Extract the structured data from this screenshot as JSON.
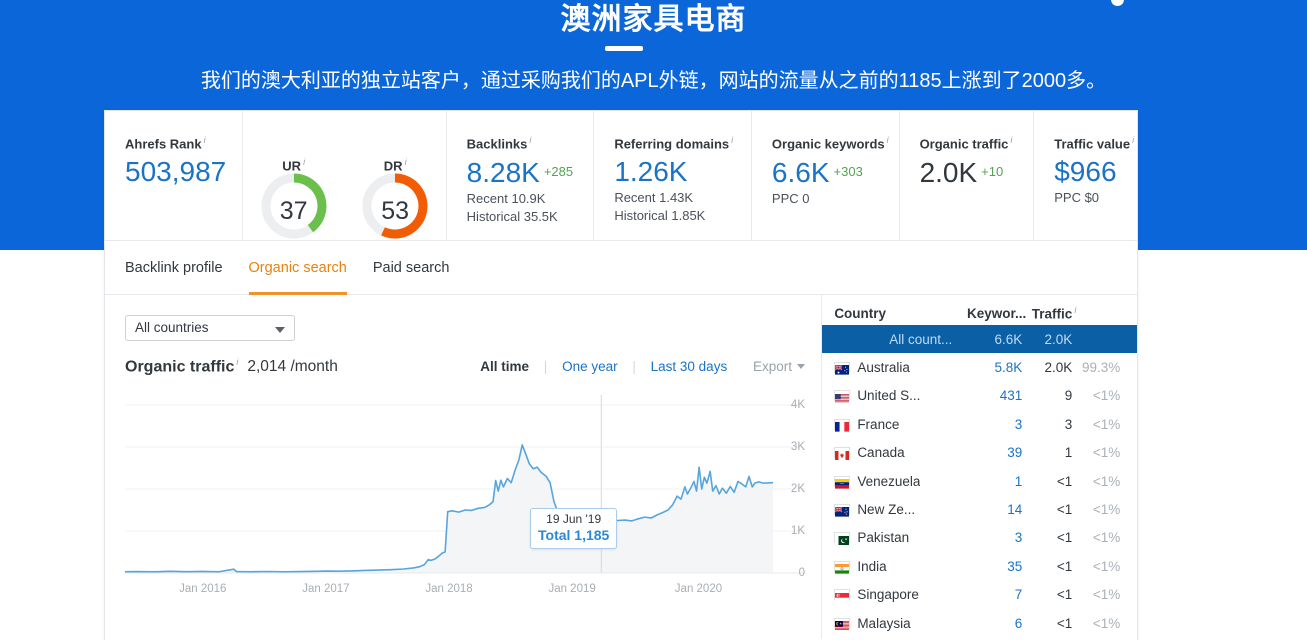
{
  "hero": {
    "title": "澳洲家具电商",
    "subtitle": "我们的澳大利亚的独立站客户，通过采购我们的APL外链，网站的流量从之前的1185上涨到了2000多。"
  },
  "metrics": {
    "ahrefs_rank": {
      "label": "Ahrefs Rank",
      "value": "503,987"
    },
    "ur": {
      "label": "UR",
      "value": "37"
    },
    "dr": {
      "label": "DR",
      "value": "53"
    },
    "backlinks": {
      "label": "Backlinks",
      "value": "8.28K",
      "delta": "+285",
      "recent": "Recent 10.9K",
      "historical": "Historical 35.5K"
    },
    "referring_domains": {
      "label": "Referring domains",
      "value": "1.26K",
      "recent": "Recent 1.43K",
      "historical": "Historical 1.85K"
    },
    "organic_keywords": {
      "label": "Organic keywords",
      "value": "6.6K",
      "delta": "+303",
      "ppc": "PPC 0"
    },
    "organic_traffic": {
      "label": "Organic traffic",
      "value": "2.0K",
      "delta": "+10"
    },
    "traffic_value": {
      "label": "Traffic value",
      "value": "$966",
      "ppc": "PPC $0"
    }
  },
  "tabs": [
    {
      "label": "Backlink profile",
      "active": false
    },
    {
      "label": "Organic search",
      "active": true
    },
    {
      "label": "Paid search",
      "active": false
    }
  ],
  "controls": {
    "country_select": "All countries",
    "chart_title": "Organic traffic",
    "chart_value": "2,014 /month",
    "ranges": [
      {
        "label": "All time",
        "active": true
      },
      {
        "label": "One year",
        "active": false
      },
      {
        "label": "Last 30 days",
        "active": false
      }
    ],
    "export_label": "Export"
  },
  "tooltip": {
    "date": "19 Jun '19",
    "total": "Total 1,185"
  },
  "country_table": {
    "headers": {
      "country": "Country",
      "keywords": "Keywor...",
      "traffic": "Traffic"
    },
    "rows": [
      {
        "country": "All count...",
        "keywords": "6.6K",
        "traffic": "2.0K",
        "share": "",
        "selected": true,
        "flag": "none"
      },
      {
        "country": "Australia",
        "keywords": "5.8K",
        "traffic": "2.0K",
        "share": "99.3%",
        "selected": false,
        "flag": "au"
      },
      {
        "country": "United S...",
        "keywords": "431",
        "traffic": "9",
        "share": "<1%",
        "selected": false,
        "flag": "us"
      },
      {
        "country": "France",
        "keywords": "3",
        "traffic": "3",
        "share": "<1%",
        "selected": false,
        "flag": "fr"
      },
      {
        "country": "Canada",
        "keywords": "39",
        "traffic": "1",
        "share": "<1%",
        "selected": false,
        "flag": "ca"
      },
      {
        "country": "Venezuela",
        "keywords": "1",
        "traffic": "<1",
        "share": "<1%",
        "selected": false,
        "flag": "ve"
      },
      {
        "country": "New Ze...",
        "keywords": "14",
        "traffic": "<1",
        "share": "<1%",
        "selected": false,
        "flag": "nz"
      },
      {
        "country": "Pakistan",
        "keywords": "3",
        "traffic": "<1",
        "share": "<1%",
        "selected": false,
        "flag": "pk"
      },
      {
        "country": "India",
        "keywords": "35",
        "traffic": "<1",
        "share": "<1%",
        "selected": false,
        "flag": "in"
      },
      {
        "country": "Singapore",
        "keywords": "7",
        "traffic": "<1",
        "share": "<1%",
        "selected": false,
        "flag": "sg"
      },
      {
        "country": "Malaysia",
        "keywords": "6",
        "traffic": "<1",
        "share": "<1%",
        "selected": false,
        "flag": "my"
      }
    ]
  },
  "colors": {
    "hero_blue": "#0b66da",
    "link_blue": "#1a73c7",
    "accent_orange": "#e8820c",
    "ur_green": "#6bbf4b",
    "dr_orange": "#f25c05",
    "selected_row": "#0b5fa5",
    "chart_line": "#57a5df"
  },
  "chart_data": {
    "type": "area",
    "title": "Organic traffic",
    "xlabel": "",
    "ylabel": "",
    "ylim": [
      0,
      4000
    ],
    "yticks": [
      0,
      1000,
      2000,
      3000,
      4000
    ],
    "ytick_labels": [
      "0",
      "1K",
      "2K",
      "3K",
      "4K"
    ],
    "xtick_labels": [
      "Jan 2016",
      "Jan 2017",
      "Jan 2018",
      "Jan 2019",
      "Jan 2020"
    ],
    "xtick_positions": [
      0.12,
      0.31,
      0.5,
      0.69,
      0.885
    ],
    "grid": true,
    "legend": "none",
    "annotation": {
      "x": 0.735,
      "y": 1185,
      "date": "19 Jun '19",
      "label": "Total 1,185"
    },
    "series": [
      {
        "name": "Organic traffic",
        "color": "#57a5df",
        "points": [
          [
            0.0,
            30
          ],
          [
            0.02,
            35
          ],
          [
            0.045,
            28
          ],
          [
            0.07,
            40
          ],
          [
            0.095,
            32
          ],
          [
            0.12,
            38
          ],
          [
            0.145,
            30
          ],
          [
            0.168,
            90
          ],
          [
            0.172,
            35
          ],
          [
            0.195,
            30
          ],
          [
            0.22,
            36
          ],
          [
            0.245,
            30
          ],
          [
            0.27,
            34
          ],
          [
            0.295,
            40
          ],
          [
            0.31,
            45
          ],
          [
            0.33,
            42
          ],
          [
            0.35,
            50
          ],
          [
            0.37,
            60
          ],
          [
            0.39,
            70
          ],
          [
            0.41,
            80
          ],
          [
            0.43,
            95
          ],
          [
            0.445,
            120
          ],
          [
            0.455,
            150
          ],
          [
            0.462,
            200
          ],
          [
            0.468,
            320
          ],
          [
            0.472,
            300
          ],
          [
            0.478,
            330
          ],
          [
            0.484,
            400
          ],
          [
            0.49,
            480
          ],
          [
            0.494,
            500
          ],
          [
            0.498,
            1460
          ],
          [
            0.505,
            1480
          ],
          [
            0.515,
            1450
          ],
          [
            0.525,
            1500
          ],
          [
            0.535,
            1490
          ],
          [
            0.545,
            1540
          ],
          [
            0.555,
            1560
          ],
          [
            0.562,
            1620
          ],
          [
            0.568,
            1700
          ],
          [
            0.572,
            2200
          ],
          [
            0.576,
            1950
          ],
          [
            0.58,
            2210
          ],
          [
            0.584,
            2050
          ],
          [
            0.59,
            2250
          ],
          [
            0.596,
            2150
          ],
          [
            0.602,
            2450
          ],
          [
            0.608,
            2700
          ],
          [
            0.613,
            3050
          ],
          [
            0.618,
            2850
          ],
          [
            0.624,
            2600
          ],
          [
            0.63,
            2480
          ],
          [
            0.636,
            2520
          ],
          [
            0.642,
            2400
          ],
          [
            0.65,
            2300
          ],
          [
            0.656,
            2150
          ],
          [
            0.662,
            1700
          ],
          [
            0.668,
            1450
          ],
          [
            0.678,
            1400
          ],
          [
            0.69,
            1390
          ],
          [
            0.705,
            1380
          ],
          [
            0.72,
            1360
          ],
          [
            0.735,
            1185
          ],
          [
            0.748,
            1230
          ],
          [
            0.76,
            1250
          ],
          [
            0.772,
            1260
          ],
          [
            0.782,
            1240
          ],
          [
            0.792,
            1290
          ],
          [
            0.802,
            1330
          ],
          [
            0.812,
            1310
          ],
          [
            0.822,
            1390
          ],
          [
            0.83,
            1440
          ],
          [
            0.838,
            1500
          ],
          [
            0.845,
            1620
          ],
          [
            0.852,
            1830
          ],
          [
            0.858,
            1760
          ],
          [
            0.864,
            2050
          ],
          [
            0.868,
            1880
          ],
          [
            0.873,
            2020
          ],
          [
            0.878,
            2180
          ],
          [
            0.882,
            1950
          ],
          [
            0.886,
            2520
          ],
          [
            0.89,
            2000
          ],
          [
            0.894,
            2280
          ],
          [
            0.898,
            2140
          ],
          [
            0.903,
            2420
          ],
          [
            0.907,
            1950
          ],
          [
            0.912,
            2080
          ],
          [
            0.917,
            1880
          ],
          [
            0.922,
            2020
          ],
          [
            0.928,
            1900
          ],
          [
            0.934,
            2060
          ],
          [
            0.94,
            1920
          ],
          [
            0.946,
            2180
          ],
          [
            0.952,
            2120
          ],
          [
            0.958,
            2050
          ],
          [
            0.963,
            2300
          ],
          [
            0.968,
            2050
          ],
          [
            0.972,
            2140
          ],
          [
            0.978,
            2170
          ],
          [
            0.985,
            2140
          ],
          [
            1.0,
            2150
          ]
        ]
      }
    ]
  }
}
